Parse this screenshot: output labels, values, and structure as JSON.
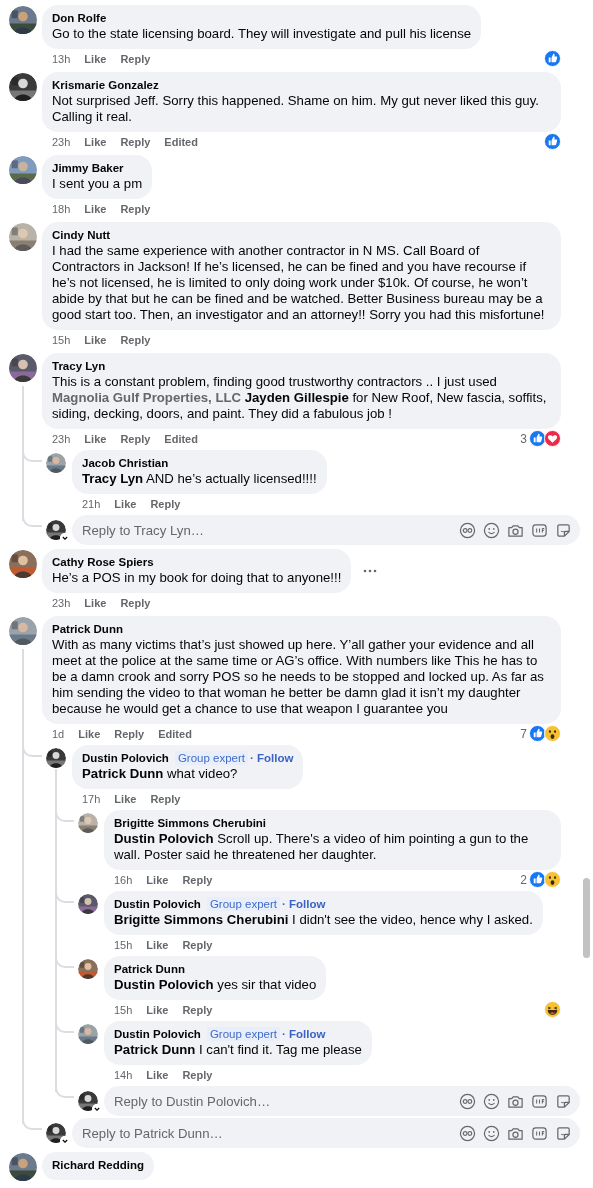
{
  "comments": [
    {
      "author": "Don Rolfe",
      "body": [
        {
          "kind": "plain",
          "text": "Go to the state licensing board. They will investigate and pull his license"
        }
      ],
      "time": "13h",
      "actions": [
        "Like",
        "Reply"
      ],
      "reactions": [
        {
          "kind": "like"
        }
      ]
    },
    {
      "author": "Krismarie Gonzalez",
      "body": [
        {
          "kind": "plain",
          "text": "Not surprised Jeff. Sorry this happened. Shame on him. My gut never liked this guy. Calling it real."
        }
      ],
      "time": "23h",
      "actions": [
        "Like",
        "Reply"
      ],
      "edited": "Edited",
      "reactions": [
        {
          "kind": "like"
        }
      ]
    },
    {
      "author": "Jimmy Baker",
      "body": [
        {
          "kind": "plain",
          "text": "I sent you a pm"
        }
      ],
      "time": "18h",
      "actions": [
        "Like",
        "Reply"
      ]
    },
    {
      "author": "Cindy Nutt",
      "body": [
        {
          "kind": "plain",
          "text": "I had the same experience with another contractor in N MS. Call Board of Contractors in Jackson! If he’s licensed, he can be fined and you have recourse if he’s not licensed, he is limited to only doing work under $10k. Of course, he won’t abide by that but he can be fined and be watched. Better Business bureau may be a good start too. Then, an investigator and an attorney!! Sorry you had this misfortune!"
        }
      ],
      "time": "15h",
      "actions": [
        "Like",
        "Reply"
      ]
    },
    {
      "author": "Tracy Lyn",
      "body": [
        {
          "kind": "plain",
          "text": "This is a constant problem, finding good trustworthy contractors .. I just used "
        },
        {
          "kind": "page",
          "text": "Magnolia Gulf Properties, LLC "
        },
        {
          "kind": "mention",
          "text": "Jayden Gillespie"
        },
        {
          "kind": "plain",
          "text": " for New Roof, New fascia, soffits, siding, decking, doors, and paint. They did a fabulous job !"
        }
      ],
      "time": "23h",
      "actions": [
        "Like",
        "Reply"
      ],
      "edited": "Edited",
      "reaction_count": "3",
      "reactions": [
        {
          "kind": "like"
        },
        {
          "kind": "love"
        }
      ],
      "replies": [
        {
          "author": "Jacob Christian",
          "body": [
            {
              "kind": "mention",
              "text": "Tracy Lyn"
            },
            {
              "kind": "plain",
              "text": " AND he’s actually licensed!!!!"
            }
          ],
          "time": "21h",
          "actions": [
            "Like",
            "Reply"
          ]
        }
      ],
      "reply_box": {
        "placeholder": "Reply to Tracy Lyn…"
      }
    },
    {
      "author": "Cathy Rose Spiers",
      "body": [
        {
          "kind": "plain",
          "text": "He’s a POS in my book for doing that to anyone!!!"
        }
      ],
      "time": "23h",
      "actions": [
        "Like",
        "Reply"
      ],
      "more_button": true
    },
    {
      "author": "Patrick Dunn",
      "body": [
        {
          "kind": "plain",
          "text": "With as many victims that’s just showed up here. Y’all gather your evidence and all meet at the police at the same time or AG’s office. With numbers like This he has to be a damn crook and sorry POS so he needs to be stopped and locked up. As far as him sending the video to that woman he better be damn glad it isn’t my daughter because he would get a chance to use that weapon I guarantee you"
        }
      ],
      "time": "1d",
      "actions": [
        "Like",
        "Reply"
      ],
      "edited": "Edited",
      "reaction_count": "7",
      "reactions": [
        {
          "kind": "like"
        },
        {
          "kind": "wow"
        }
      ],
      "replies": [
        {
          "author": "Dustin Polovich",
          "badge": "Group expert",
          "follow": "· Follow",
          "body": [
            {
              "kind": "mention",
              "text": "Patrick Dunn"
            },
            {
              "kind": "plain",
              "text": " what video?"
            }
          ],
          "time": "17h",
          "actions": [
            "Like",
            "Reply"
          ],
          "replies": [
            {
              "author": "Brigitte Simmons Cherubini",
              "body": [
                {
                  "kind": "mention",
                  "text": "Dustin Polovich"
                },
                {
                  "kind": "plain",
                  "text": " Scroll up. There's a video of him pointing a gun to the wall. Poster said he threatened her daughter."
                }
              ],
              "time": "16h",
              "actions": [
                "Like",
                "Reply"
              ],
              "reaction_count": "2",
              "reactions": [
                {
                  "kind": "like"
                },
                {
                  "kind": "wow"
                }
              ]
            },
            {
              "author": "Dustin Polovich",
              "badge": "Group expert",
              "follow": "· Follow",
              "body": [
                {
                  "kind": "mention",
                  "text": "Brigitte Simmons Cherubini"
                },
                {
                  "kind": "plain",
                  "text": " I didn't see the video, hence why I asked."
                }
              ],
              "time": "15h",
              "actions": [
                "Like",
                "Reply"
              ]
            },
            {
              "author": "Patrick Dunn",
              "body": [
                {
                  "kind": "mention",
                  "text": "Dustin Polovich"
                },
                {
                  "kind": "plain",
                  "text": " yes sir that video"
                }
              ],
              "time": "15h",
              "actions": [
                "Like",
                "Reply"
              ],
              "reactions": [
                {
                  "kind": "haha"
                }
              ]
            },
            {
              "author": "Dustin Polovich",
              "badge": "Group expert",
              "follow": "· Follow",
              "body": [
                {
                  "kind": "mention",
                  "text": "Patrick Dunn"
                },
                {
                  "kind": "plain",
                  "text": " I can't find it. Tag me please"
                }
              ],
              "time": "14h",
              "actions": [
                "Like",
                "Reply"
              ]
            }
          ],
          "reply_box": {
            "placeholder": "Reply to Dustin Polovich…"
          }
        }
      ],
      "reply_box": {
        "placeholder": "Reply to Patrick Dunn…"
      }
    },
    {
      "author": "Richard Redding"
    }
  ]
}
